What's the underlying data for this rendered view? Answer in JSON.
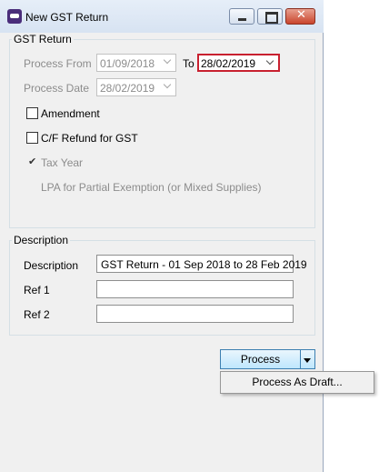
{
  "window": {
    "title": "New GST Return"
  },
  "gst_group": {
    "title": "GST Return",
    "process_from_label": "Process From",
    "process_from_value": "01/09/2018",
    "to_label": "To",
    "to_value": "28/02/2019",
    "process_date_label": "Process Date",
    "process_date_value": "28/02/2019",
    "amendment_label": "Amendment",
    "amendment_checked": false,
    "cf_refund_label": "C/F Refund for GST",
    "cf_refund_checked": false,
    "tax_year_label": "Tax Year",
    "lpa_label": "LPA for Partial Exemption (or Mixed Supplies)"
  },
  "description_group": {
    "title": "Description",
    "description_label": "Description",
    "description_value": "GST Return - 01 Sep 2018 to 28 Feb 2019",
    "ref1_label": "Ref 1",
    "ref1_value": "",
    "ref2_label": "Ref 2",
    "ref2_value": ""
  },
  "actions": {
    "process_label": "Process",
    "menu": {
      "process_as_draft_label": "Process As Draft..."
    }
  },
  "colors": {
    "active_field_border": "#c8202f",
    "button_border": "#3c7fb1"
  }
}
